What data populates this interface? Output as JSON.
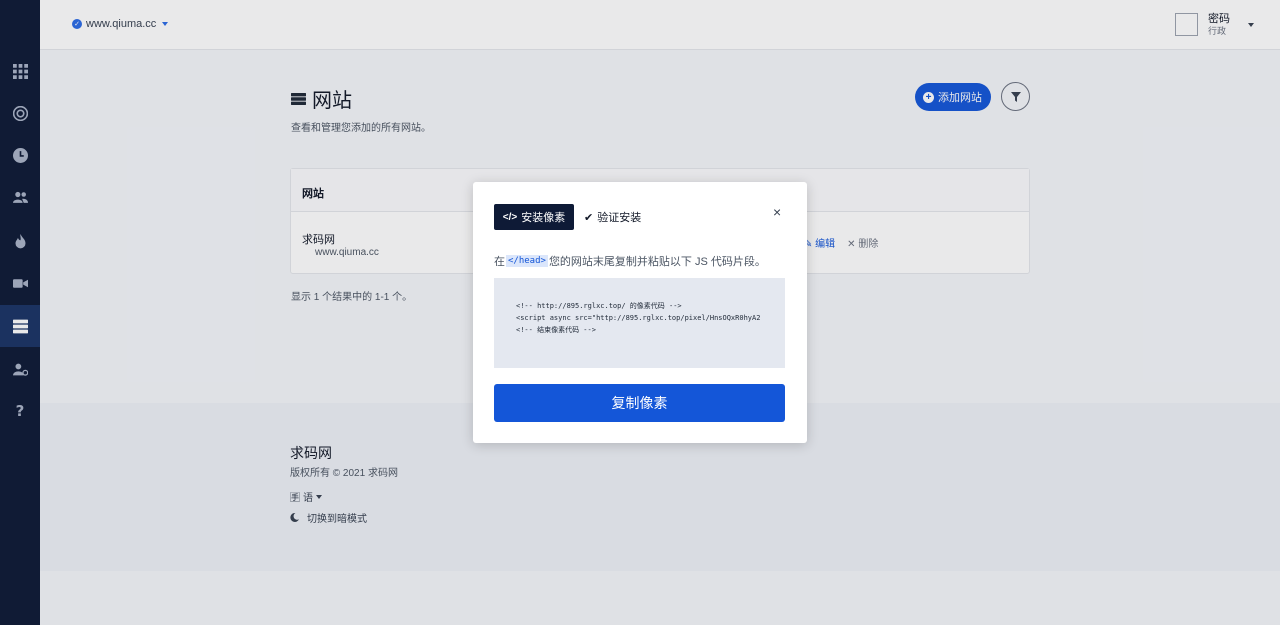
{
  "topbar": {
    "site": "www.qiuma.cc",
    "user_name": "密码",
    "user_role": "行政"
  },
  "page": {
    "title": "网站",
    "subtitle": "查看和管理您添加的所有网站。",
    "add_button": "添加网站"
  },
  "table": {
    "header": "网站",
    "rows": [
      {
        "name": "求码网",
        "url": "www.qiuma.cc",
        "edit": "编辑",
        "delete": "删除"
      }
    ],
    "results": "显示 1 个结果中的 1-1 个。"
  },
  "footer": {
    "brand": "求码网",
    "copyright": "版权所有 © 2021 求码网",
    "language": "语",
    "dark_mode": "切换到暗模式"
  },
  "modal": {
    "tab_install": "安装像素",
    "tab_verify": "验证安装",
    "instruction_prefix": "在",
    "instruction_tag": "</head>",
    "instruction_suffix": "您的网站末尾复制并粘贴以下 JS 代码片段。",
    "code_line1": "<!-- http://895.rglxc.top/ 的像素代码 -->",
    "code_line2": "<script async src=\"http://895.rglxc.top/pixel/HnsOQxR0hyA2",
    "code_line3": "<!-- 结束像素代码 -->",
    "copy_button": "复制像素"
  }
}
